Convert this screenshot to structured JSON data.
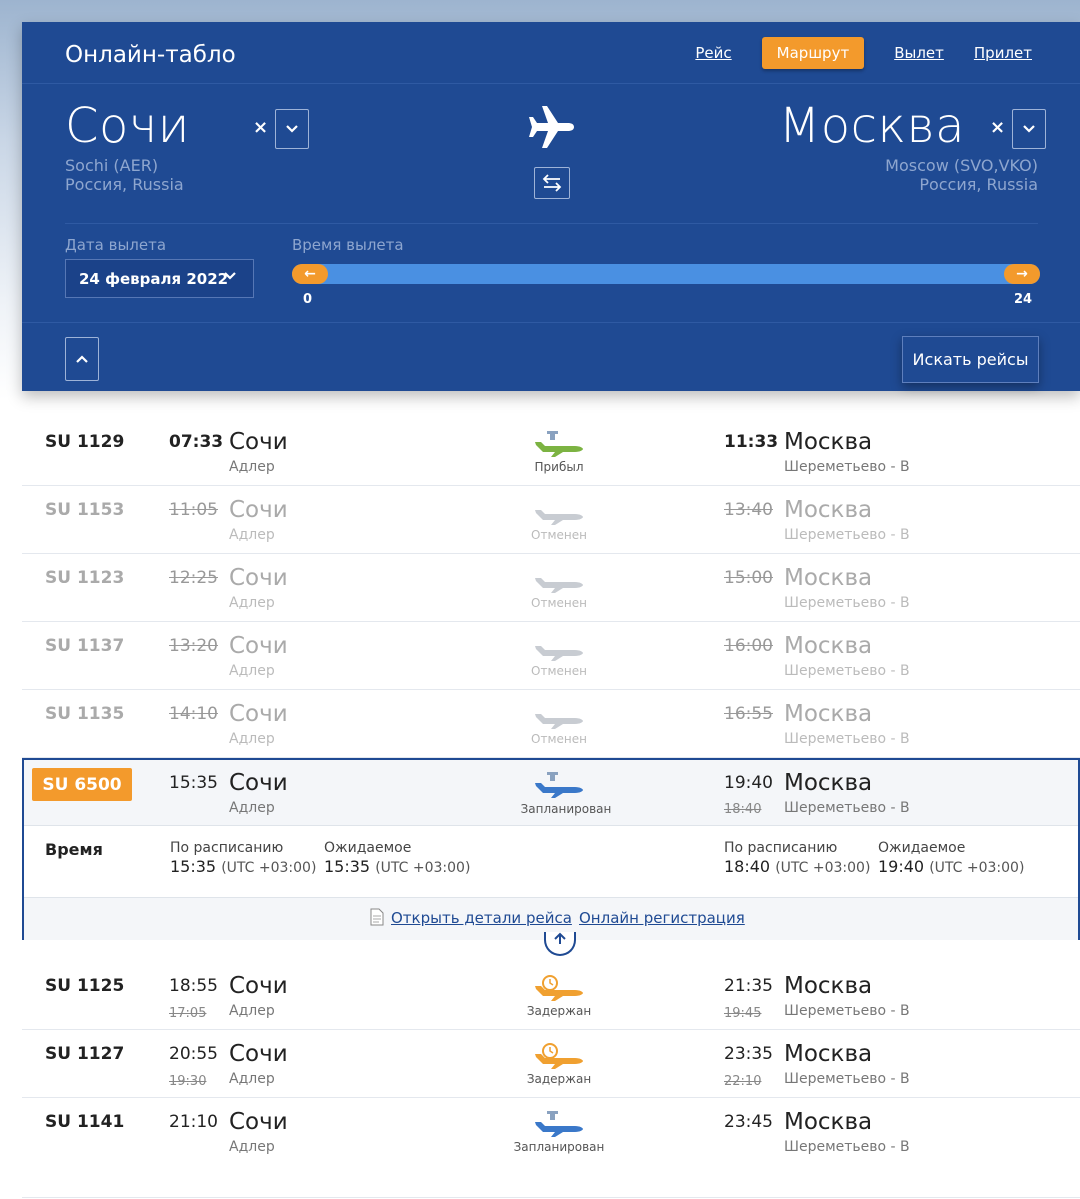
{
  "board": {
    "title": "Онлайн-табло",
    "tabs": [
      "Рейс",
      "Маршрут",
      "Вылет",
      "Прилет"
    ],
    "active_tab": "Маршрут",
    "from": {
      "city": "Сочи",
      "code": "Sochi (AER)",
      "country": "Россия, Russia"
    },
    "to": {
      "city": "Москва",
      "code": "Moscow (SVO,VKO)",
      "country": "Россия, Russia"
    },
    "clear_symbol": "×",
    "date_label": "Дата вылета",
    "date_value": "24 февраля 2022",
    "time_label": "Время вылета",
    "time_min": "0",
    "time_max": "24",
    "search_label": "Искать рейсы"
  },
  "flights": [
    {
      "number": "SU 1129",
      "dep_time": "07:33",
      "dep_city": "Сочи",
      "dep_airport": "Адлер",
      "status": "Прибыл",
      "arr_time": "11:33",
      "arr_city": "Москва",
      "arr_airport": "Шереметьево - B"
    },
    {
      "number": "SU 1153",
      "dep_time": "11:05",
      "dep_city": "Сочи",
      "dep_airport": "Адлер",
      "status": "Отменен",
      "arr_time": "13:40",
      "arr_city": "Москва",
      "arr_airport": "Шереметьево - B"
    },
    {
      "number": "SU 1123",
      "dep_time": "12:25",
      "dep_city": "Сочи",
      "dep_airport": "Адлер",
      "status": "Отменен",
      "arr_time": "15:00",
      "arr_city": "Москва",
      "arr_airport": "Шереметьево - B"
    },
    {
      "number": "SU 1137",
      "dep_time": "13:20",
      "dep_city": "Сочи",
      "dep_airport": "Адлер",
      "status": "Отменен",
      "arr_time": "16:00",
      "arr_city": "Москва",
      "arr_airport": "Шереметьево - B"
    },
    {
      "number": "SU 1135",
      "dep_time": "14:10",
      "dep_city": "Сочи",
      "dep_airport": "Адлер",
      "status": "Отменен",
      "arr_time": "16:55",
      "arr_city": "Москва",
      "arr_airport": "Шереметьево - B"
    }
  ],
  "expanded": {
    "number": "SU 6500",
    "dep_time": "15:35",
    "dep_city": "Сочи",
    "dep_airport": "Адлер",
    "status": "Запланирован",
    "arr_time": "19:40",
    "arr_old_time": "18:40",
    "arr_city": "Москва",
    "arr_airport": "Шереметьево - B",
    "time_heading": "Время",
    "sched_label": "По расписанию",
    "expected_label": "Ожидаемое",
    "dep_sched": "15:35",
    "dep_expected": "15:35",
    "arr_sched": "18:40",
    "arr_expected": "19:40",
    "utc": "(UTC +03:00)",
    "link_details": "Открыть детали рейса",
    "link_checkin": "Онлайн регистрация"
  },
  "flights_after": [
    {
      "number": "SU 1125",
      "dep_time": "18:55",
      "dep_old": "17:05",
      "dep_city": "Сочи",
      "dep_airport": "Адлер",
      "status": "Задержан",
      "arr_time": "21:35",
      "arr_old": "19:45",
      "arr_city": "Москва",
      "arr_airport": "Шереметьево - B"
    },
    {
      "number": "SU 1127",
      "dep_time": "20:55",
      "dep_old": "19:30",
      "dep_city": "Сочи",
      "dep_airport": "Адлер",
      "status": "Задержан",
      "arr_time": "23:35",
      "arr_old": "22:10",
      "arr_city": "Москва",
      "arr_airport": "Шереметьево - B"
    },
    {
      "number": "SU 1141",
      "dep_time": "21:10",
      "dep_city": "Сочи",
      "dep_airport": "Адлер",
      "status": "Запланирован",
      "arr_time": "23:45",
      "arr_city": "Москва",
      "arr_airport": "Шереметьево - B"
    }
  ],
  "colors": {
    "board": "#1f4a93",
    "accent": "#f39a2c",
    "arrived": "#7cb342",
    "cancelled": "#c8ccd2",
    "scheduled": "#3a78c9",
    "delayed": "#f0a030"
  },
  "icons": [
    "plane-icon",
    "swap-icon",
    "chevron-down-icon",
    "chevron-up-icon",
    "document-icon",
    "arrow-up-icon"
  ]
}
